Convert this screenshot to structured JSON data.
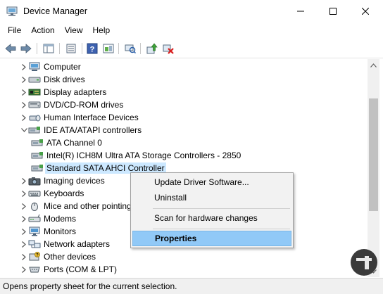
{
  "window": {
    "title": "Device Manager",
    "controls": {
      "minimize": "minimize-icon",
      "maximize": "maximize-icon",
      "close": "close-icon"
    }
  },
  "menu": [
    "File",
    "Action",
    "View",
    "Help"
  ],
  "toolbar": {
    "icons": [
      "back-arrow-icon",
      "forward-arrow-icon",
      "properties-list-icon",
      "device-list-icon",
      "help-icon",
      "show-hidden-icon",
      "scan-hardware-icon",
      "update-driver-icon",
      "uninstall-device-icon"
    ]
  },
  "tree": {
    "items": [
      {
        "label": "Computer",
        "expanded": false,
        "icon": "computer-icon"
      },
      {
        "label": "Disk drives",
        "expanded": false,
        "icon": "disk-drive-icon"
      },
      {
        "label": "Display adapters",
        "expanded": false,
        "icon": "display-adapter-icon"
      },
      {
        "label": "DVD/CD-ROM drives",
        "expanded": false,
        "icon": "dvd-drive-icon"
      },
      {
        "label": "Human Interface Devices",
        "expanded": false,
        "icon": "hid-icon"
      },
      {
        "label": "IDE ATA/ATAPI controllers",
        "expanded": true,
        "icon": "ide-controller-icon"
      },
      {
        "label": "ATA Channel 0",
        "child": true,
        "icon": "ide-controller-icon"
      },
      {
        "label": "Intel(R) ICH8M Ultra ATA Storage Controllers - 2850",
        "child": true,
        "icon": "ide-controller-icon"
      },
      {
        "label": "Standard SATA AHCI Controller",
        "child": true,
        "selected": true,
        "icon": "ide-controller-icon"
      },
      {
        "label": "Imaging devices",
        "expanded": false,
        "icon": "camera-icon"
      },
      {
        "label": "Keyboards",
        "expanded": false,
        "icon": "keyboard-icon"
      },
      {
        "label": "Mice and other pointing devices",
        "expanded": false,
        "icon": "mouse-icon"
      },
      {
        "label": "Modems",
        "expanded": false,
        "icon": "modem-icon"
      },
      {
        "label": "Monitors",
        "expanded": false,
        "icon": "monitor-icon"
      },
      {
        "label": "Network adapters",
        "expanded": false,
        "icon": "network-adapter-icon"
      },
      {
        "label": "Other devices",
        "expanded": false,
        "icon": "other-devices-icon"
      },
      {
        "label": "Ports (COM & LPT)",
        "expanded": false,
        "icon": "port-icon"
      }
    ]
  },
  "context_menu": {
    "items": [
      "Update Driver Software...",
      "Uninstall",
      "Scan for hardware changes",
      "Properties"
    ],
    "highlighted": "Properties"
  },
  "status": {
    "text": "Opens property sheet for the current selection."
  },
  "colors": {
    "selection": "#cce8ff",
    "menu_highlight": "#91c9f7",
    "scrollbar_track": "#f0f0f0",
    "scrollbar_thumb": "#c1c1c1"
  }
}
